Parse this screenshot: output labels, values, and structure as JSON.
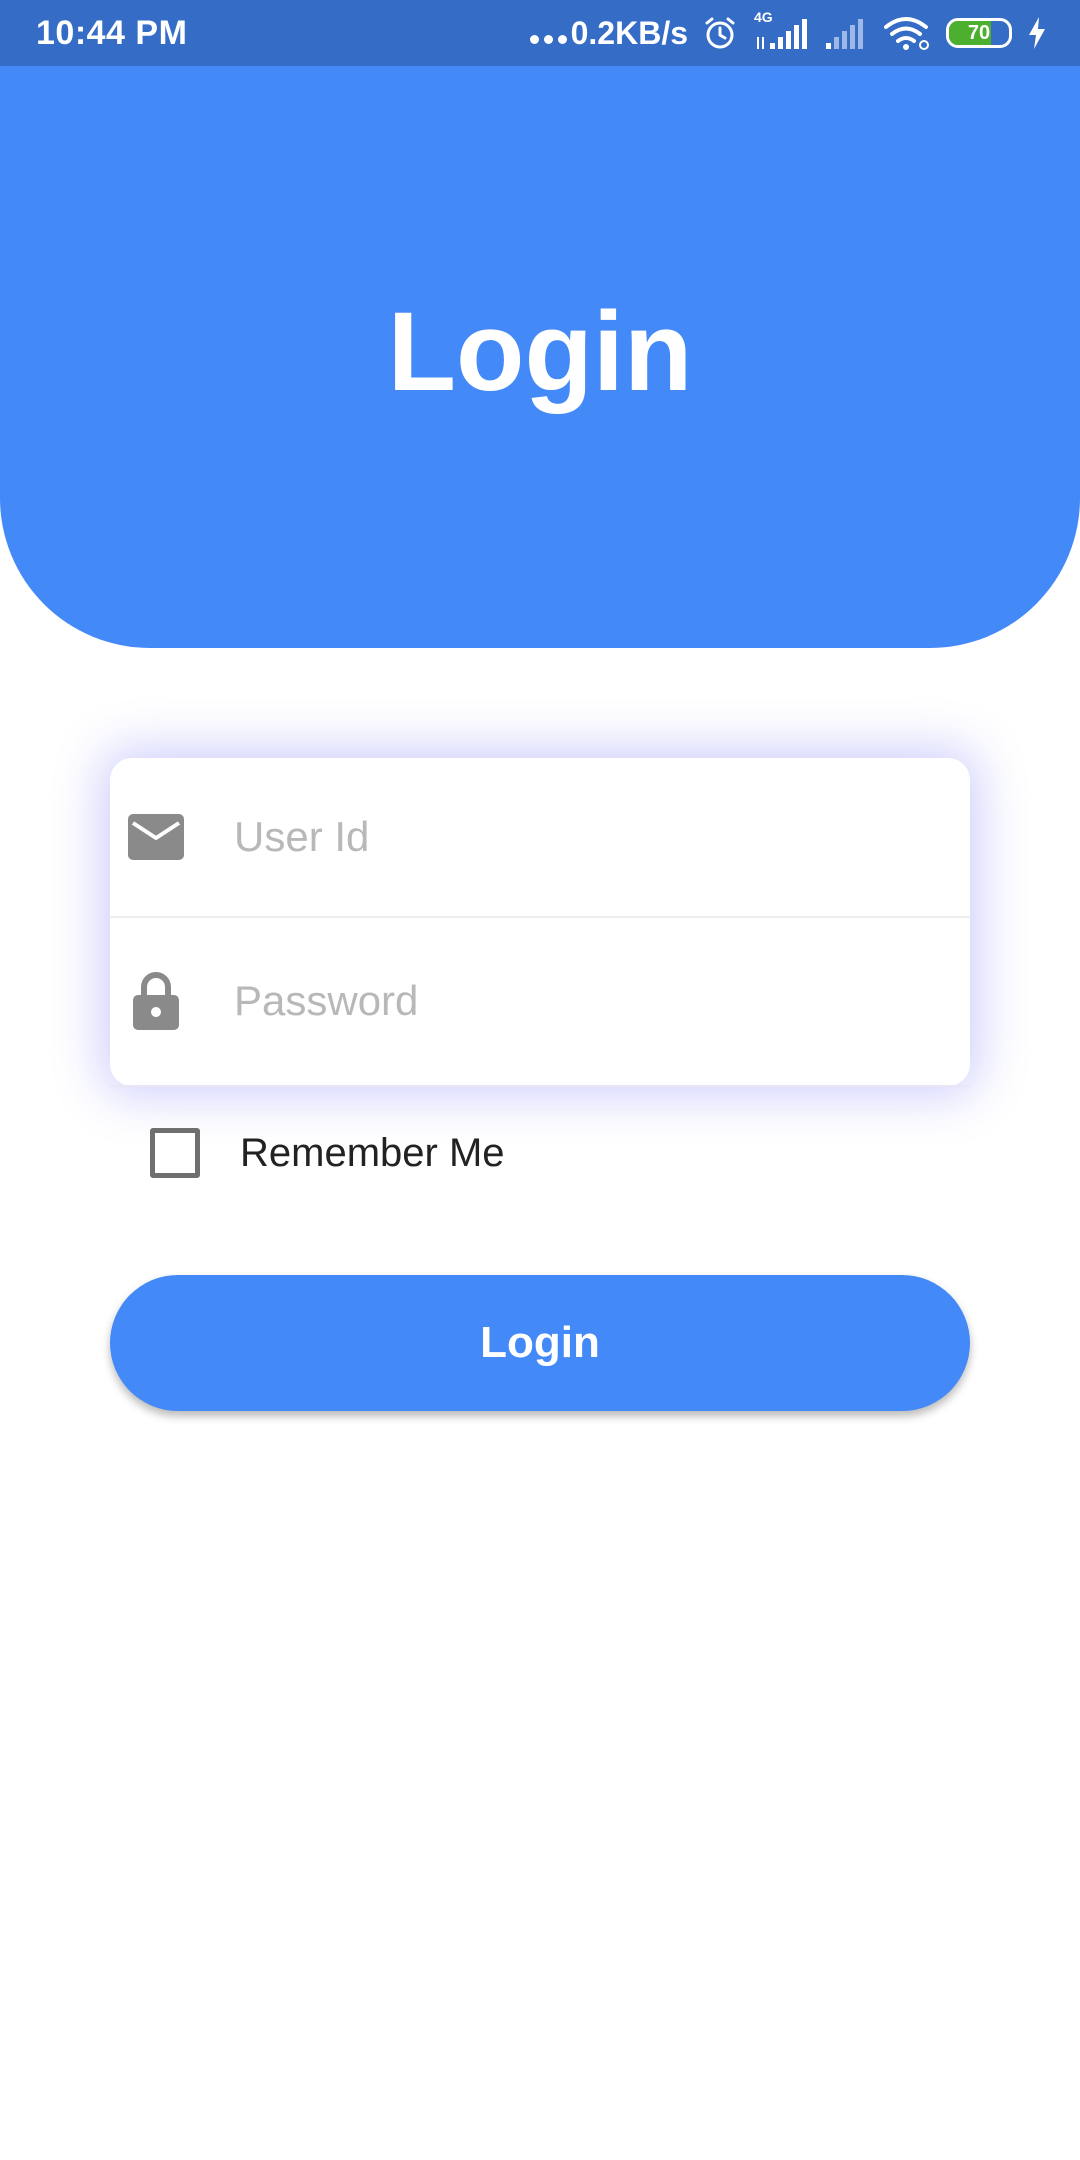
{
  "status_bar": {
    "time": "10:44 PM",
    "network_speed": "0.2KB/s",
    "network_type": "4G",
    "battery_level": "70",
    "battery_fraction": 0.7,
    "icons": [
      "more-dots-icon",
      "alarm-icon",
      "signal-4g-icon",
      "signal-icon",
      "wifi-icon",
      "battery-icon",
      "charging-bolt-icon"
    ]
  },
  "header": {
    "title": "Login"
  },
  "form": {
    "user_id_placeholder": "User Id",
    "user_id_value": "",
    "user_id_icon": "mail-icon",
    "password_placeholder": "Password",
    "password_value": "",
    "password_icon": "lock-icon"
  },
  "remember_me": {
    "label": "Remember Me",
    "checked": false
  },
  "login_button": {
    "label": "Login"
  },
  "colors": {
    "status_bar": "#356cc6",
    "primary": "#4489f8",
    "icon_gray": "#8a8a8a",
    "placeholder": "#b8b8b8",
    "battery_fill": "#4caf2e"
  }
}
